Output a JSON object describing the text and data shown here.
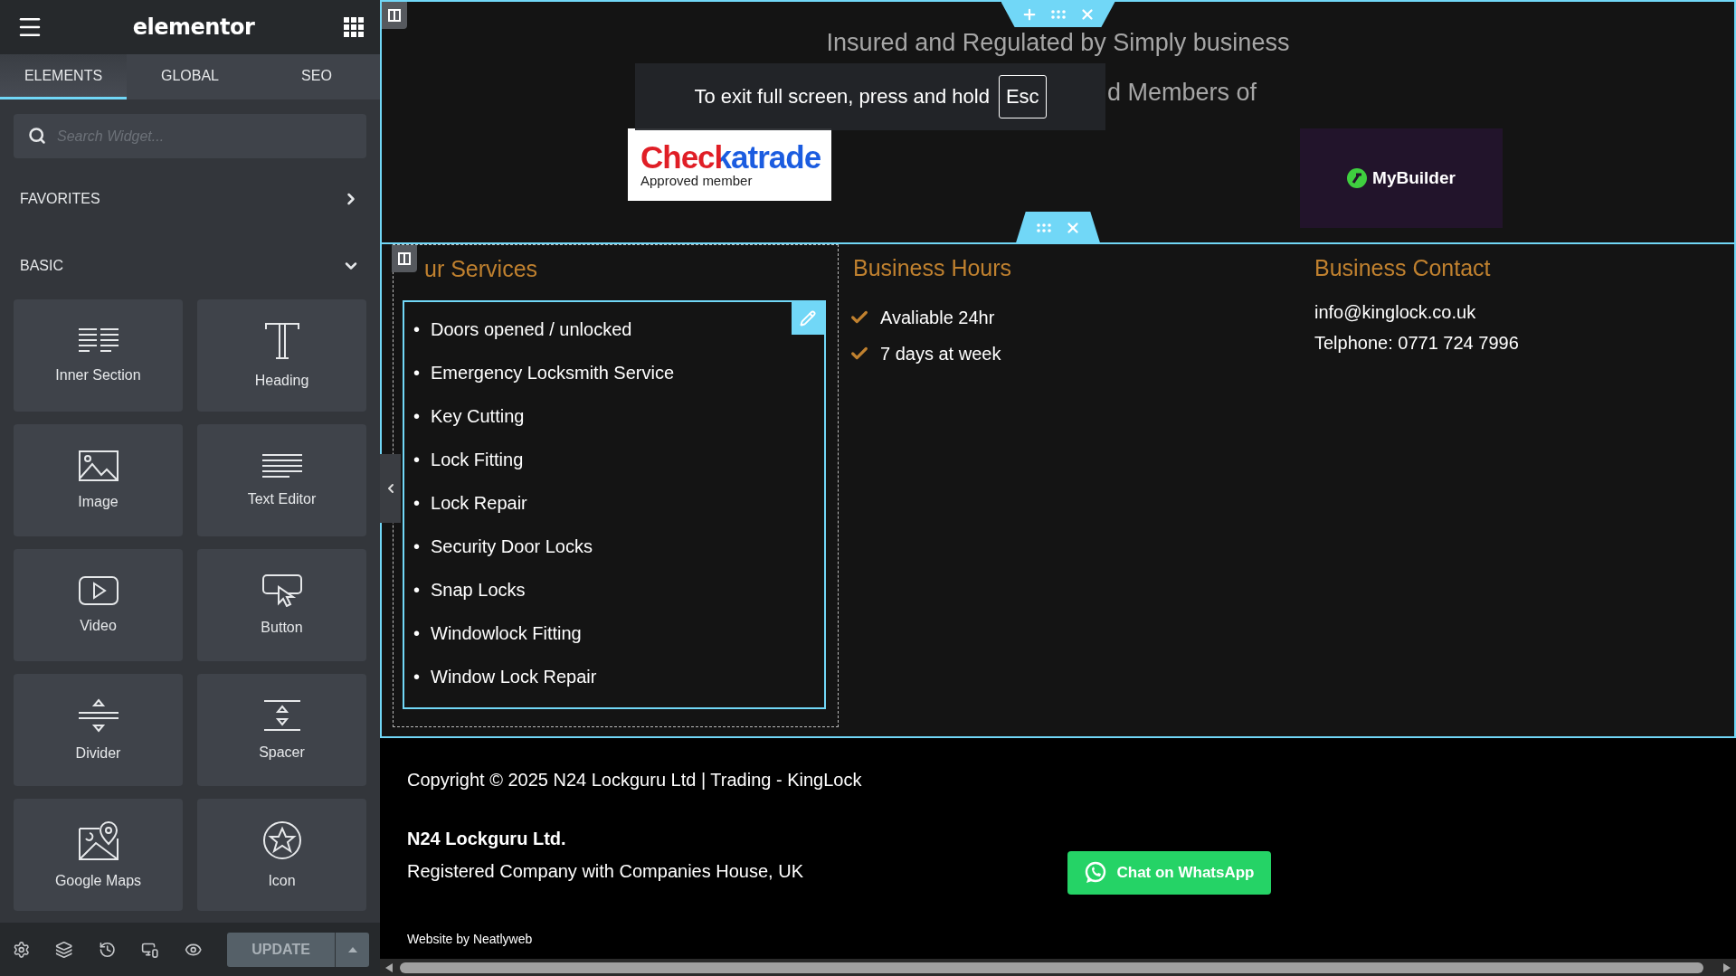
{
  "sidebar": {
    "logo": "elementor",
    "tabs": [
      {
        "label": "ELEMENTS",
        "selected": true
      },
      {
        "label": "GLOBAL",
        "selected": false
      },
      {
        "label": "SEO",
        "selected": false
      }
    ],
    "search": {
      "placeholder": "Search Widget..."
    },
    "categories": [
      {
        "label": "FAVORITES",
        "expanded": false
      },
      {
        "label": "BASIC",
        "expanded": true
      }
    ],
    "widgets": [
      {
        "label": "Inner Section"
      },
      {
        "label": "Heading"
      },
      {
        "label": "Image"
      },
      {
        "label": "Text Editor"
      },
      {
        "label": "Video"
      },
      {
        "label": "Button"
      },
      {
        "label": "Divider"
      },
      {
        "label": "Spacer"
      },
      {
        "label": "Google Maps"
      },
      {
        "label": "Icon"
      }
    ],
    "update_button": "UPDATE"
  },
  "canvas": {
    "top_section": {
      "lines": [
        "Insured and Regulated by Simply business",
        "d Members of"
      ],
      "checkatrade": {
        "name": "Checkatrade",
        "tagline": "Approved member"
      },
      "mybuilder": {
        "name": "MyBuilder"
      }
    },
    "fullscreen_toast": {
      "message": "To exit full screen, press and hold",
      "key": "Esc"
    },
    "services": {
      "heading": "ur Services",
      "marker": "•",
      "items": [
        "Doors opened / unlocked",
        "Emergency Locksmith Service",
        "Key  Cutting",
        "Lock Fitting",
        "Lock Repair",
        "Security Door Locks",
        "Snap Locks",
        "Windowlock Fitting",
        "Window Lock Repair"
      ]
    },
    "hours": {
      "heading": "Business Hours",
      "items": [
        "Avaliable 24hr",
        "7 days at week"
      ]
    },
    "contact": {
      "heading": "Business Contact",
      "lines": [
        "info@kinglock.co.uk",
        "Telphone: 0771 724 7996"
      ]
    },
    "footer": {
      "copyright": "Copyright © 2025 N24 Lockguru Ltd | Trading - KingLock",
      "company": "N24 Lockguru Ltd.",
      "registration": "Registered Company with Companies House, UK",
      "whatsapp_button": "Chat on WhatsApp",
      "credit": "Website by Neatlyweb"
    }
  }
}
